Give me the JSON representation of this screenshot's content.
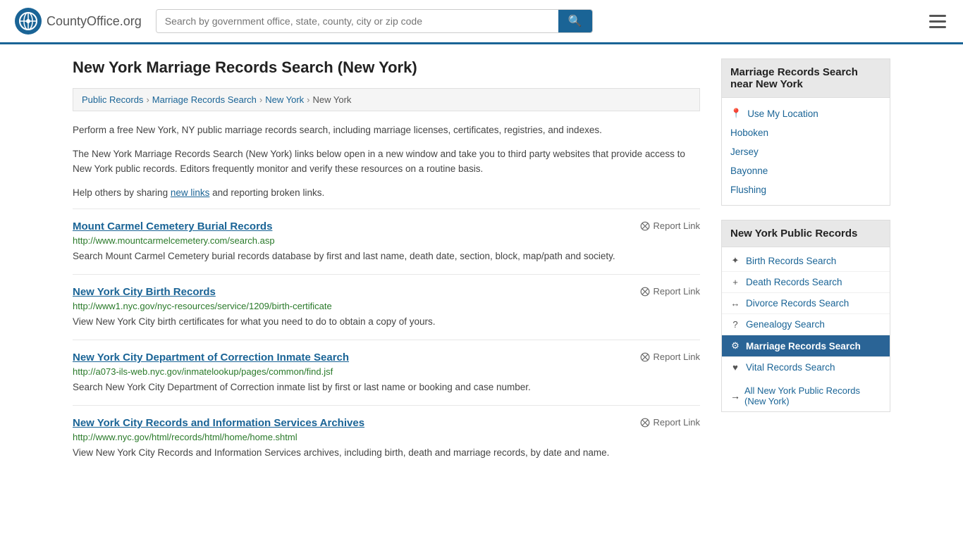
{
  "header": {
    "logo_text": "CountyOffice",
    "logo_suffix": ".org",
    "search_placeholder": "Search by government office, state, county, city or zip code",
    "search_value": ""
  },
  "page": {
    "title": "New York Marriage Records Search (New York)"
  },
  "breadcrumb": {
    "items": [
      "Public Records",
      "Marriage Records Search",
      "New York",
      "New York"
    ]
  },
  "description": {
    "para1": "Perform a free New York, NY public marriage records search, including marriage licenses, certificates, registries, and indexes.",
    "para2": "The New York Marriage Records Search (New York) links below open in a new window and take you to third party websites that provide access to New York public records. Editors frequently monitor and verify these resources on a routine basis.",
    "para3_prefix": "Help others by sharing ",
    "para3_link": "new links",
    "para3_suffix": " and reporting broken links."
  },
  "records": [
    {
      "title": "Mount Carmel Cemetery Burial Records",
      "url": "http://www.mountcarmelcemetery.com/search.asp",
      "desc": "Search Mount Carmel Cemetery burial records database by first and last name, death date, section, block, map/path and society.",
      "report_label": "Report Link"
    },
    {
      "title": "New York City Birth Records",
      "url": "http://www1.nyc.gov/nyc-resources/service/1209/birth-certificate",
      "desc": "View New York City birth certificates for what you need to do to obtain a copy of yours.",
      "report_label": "Report Link"
    },
    {
      "title": "New York City Department of Correction Inmate Search",
      "url": "http://a073-ils-web.nyc.gov/inmatelookup/pages/common/find.jsf",
      "desc": "Search New York City Department of Correction inmate list by first or last name or booking and case number.",
      "report_label": "Report Link"
    },
    {
      "title": "New York City Records and Information Services Archives",
      "url": "http://www.nyc.gov/html/records/html/home/home.shtml",
      "desc": "View New York City Records and Information Services archives, including birth, death and marriage records, by date and name.",
      "report_label": "Report Link"
    }
  ],
  "sidebar": {
    "nearby_title": "Marriage Records Search near New York",
    "use_my_location": "Use My Location",
    "nearby_places": [
      "Hoboken",
      "Jersey",
      "Bayonne",
      "Flushing"
    ],
    "public_records_title": "New York Public Records",
    "public_records": [
      {
        "icon": "✦",
        "label": "Birth Records Search",
        "active": false
      },
      {
        "icon": "+",
        "label": "Death Records Search",
        "active": false
      },
      {
        "icon": "↔",
        "label": "Divorce Records Search",
        "active": false
      },
      {
        "icon": "?",
        "label": "Genealogy Search",
        "active": false
      },
      {
        "icon": "⚙",
        "label": "Marriage Records Search",
        "active": true
      },
      {
        "icon": "♥",
        "label": "Vital Records Search",
        "active": false
      }
    ],
    "all_records_label": "All New York Public Records (New York)",
    "all_records_icon": "→"
  }
}
